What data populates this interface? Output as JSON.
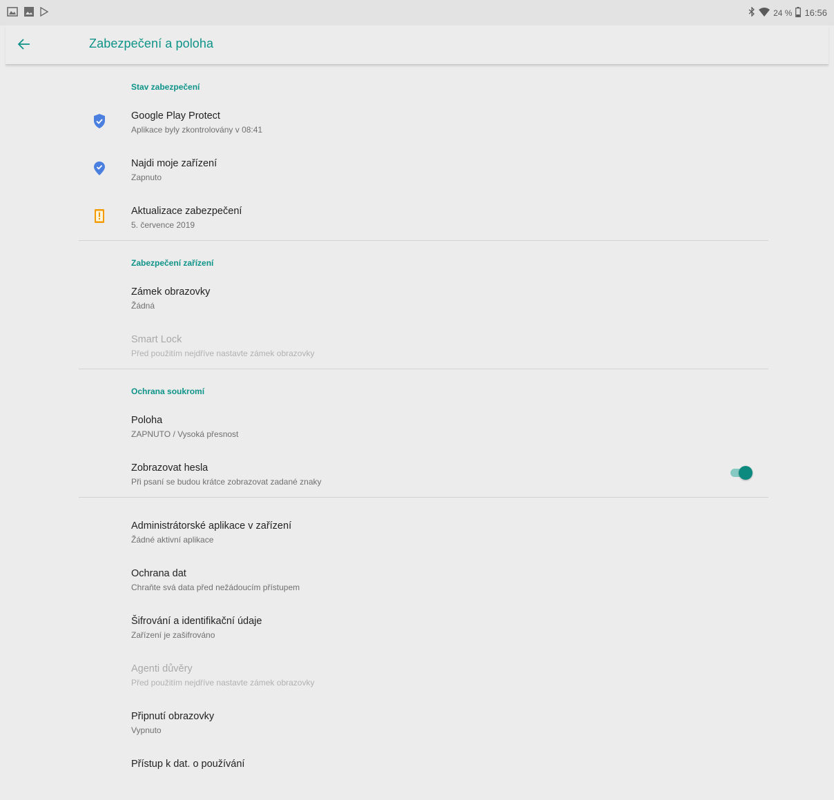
{
  "status_bar": {
    "left_icons": [
      "photo-notification-icon",
      "image-notification-icon",
      "play-store-icon"
    ],
    "battery_percent": "24 %",
    "time": "16:56",
    "right_icons": [
      "bluetooth-icon",
      "wifi-icon",
      "battery-icon"
    ]
  },
  "app_bar": {
    "title": "Zabezpečení a poloha",
    "back_icon": "arrow-back-icon"
  },
  "colors": {
    "accent": "#0d9388",
    "shield_blue": "#4a7fe0",
    "warning_orange": "#f29a00"
  },
  "sections": {
    "security_status": {
      "header": "Stav zabezpečení",
      "items": [
        {
          "title": "Google Play Protect",
          "summary": "Aplikace byly zkontrolovány v 08:41",
          "icon": "shield-check-icon"
        },
        {
          "title": "Najdi moje zařízení",
          "summary": "Zapnuto",
          "icon": "location-check-icon"
        },
        {
          "title": "Aktualizace zabezpečení",
          "summary": "5. července 2019",
          "icon": "phone-alert-icon"
        }
      ]
    },
    "device_security": {
      "header": "Zabezpečení zařízení",
      "items": [
        {
          "title": "Zámek obrazovky",
          "summary": "Žádná"
        },
        {
          "title": "Smart Lock",
          "summary": "Před použitím nejdříve nastavte zámek obrazovky",
          "disabled": true
        }
      ]
    },
    "privacy": {
      "header": "Ochrana soukromí",
      "items": [
        {
          "title": "Poloha",
          "summary": "ZAPNUTO / Vysoká přesnost"
        },
        {
          "title": "Zobrazovat hesla",
          "summary": "Při psaní se budou krátce zobrazovat zadané znaky",
          "toggle": true
        }
      ]
    },
    "other": {
      "items": [
        {
          "title": "Administrátorské aplikace v zařízení",
          "summary": "Žádné aktivní aplikace"
        },
        {
          "title": "Ochrana dat",
          "summary": "Chraňte svá data před nežádoucím přístupem"
        },
        {
          "title": "Šifrování a identifikační údaje",
          "summary": "Zařízení je zašifrováno"
        },
        {
          "title": "Agenti důvěry",
          "summary": "Před použitím nejdříve nastavte zámek obrazovky",
          "disabled": true
        },
        {
          "title": "Připnutí obrazovky",
          "summary": "Vypnuto"
        },
        {
          "title": "Přístup k dat. o používání",
          "summary": ""
        }
      ]
    }
  }
}
